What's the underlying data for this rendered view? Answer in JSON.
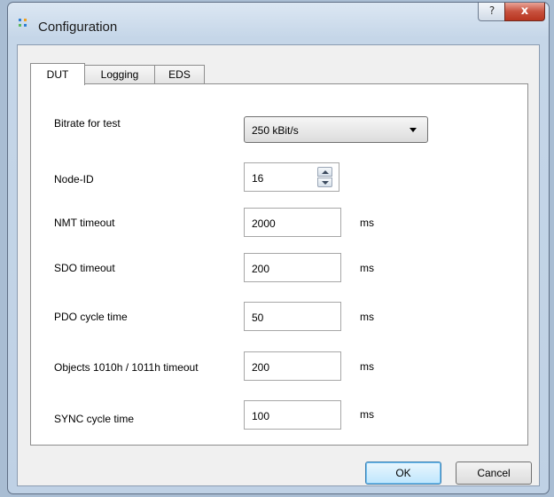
{
  "window": {
    "title": "Configuration",
    "help_label": "?",
    "close_label": "x"
  },
  "tabs": [
    {
      "label": "DUT",
      "active": true
    },
    {
      "label": "Logging",
      "active": false
    },
    {
      "label": "EDS",
      "active": false
    }
  ],
  "dut": {
    "bitrate": {
      "label": "Bitrate for test",
      "value": "250 kBit/s"
    },
    "node_id": {
      "label": "Node-ID",
      "value": "16"
    },
    "nmt_timeout": {
      "label": "NMT timeout",
      "value": "2000",
      "unit": "ms"
    },
    "sdo_timeout": {
      "label": "SDO timeout",
      "value": "200",
      "unit": "ms"
    },
    "pdo_cycle": {
      "label": "PDO cycle time",
      "value": "50",
      "unit": "ms"
    },
    "objects_timeout": {
      "label": "Objects 1010h / 1011h timeout",
      "value": "200",
      "unit": "ms"
    },
    "sync_cycle": {
      "label": "SYNC cycle time",
      "value": "100",
      "unit": "ms"
    }
  },
  "buttons": {
    "ok": "OK",
    "cancel": "Cancel"
  },
  "icons": {
    "app": "configuration-app-icon",
    "help": "help-icon",
    "close": "close-icon",
    "dropdown": "chevron-down-icon",
    "spin_up": "spin-up-icon",
    "spin_down": "spin-down-icon"
  },
  "colors": {
    "close_button": "#c7513e",
    "default_button_border": "#3c7fb1"
  }
}
